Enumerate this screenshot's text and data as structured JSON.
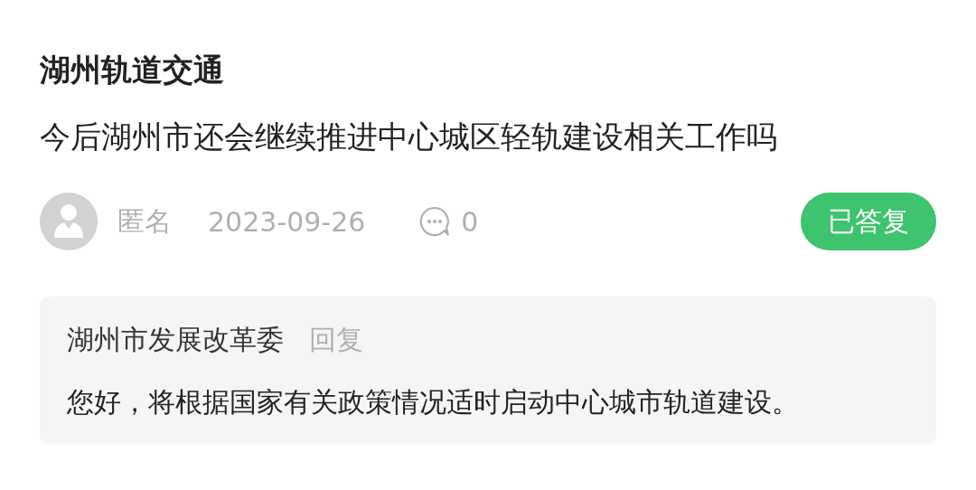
{
  "category": "湖州轨道交通",
  "question": "今后湖州市还会继续推进中心城区轻轨建设相关工作吗",
  "meta": {
    "author": "匿名",
    "date": "2023-09-26",
    "comment_count": "0"
  },
  "status": {
    "label": "已答复",
    "color": "#3ec36e"
  },
  "reply": {
    "department": "湖州市发展改革委",
    "action": "回复",
    "text": "您好，将根据国家有关政策情况适时启动中心城市轨道建设。"
  }
}
